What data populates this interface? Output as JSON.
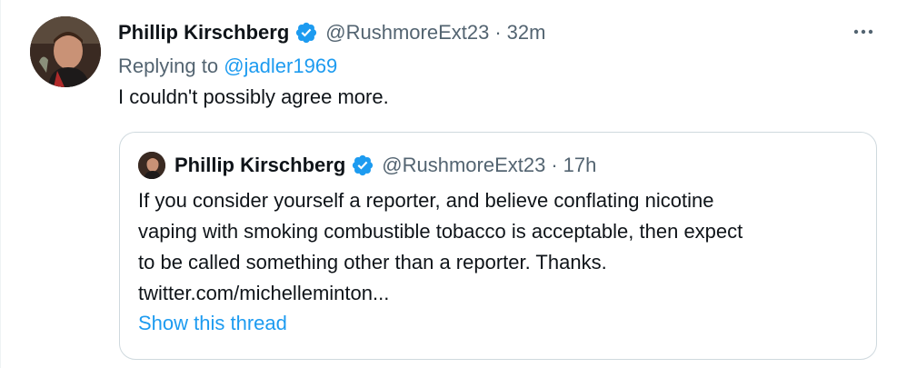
{
  "tweet": {
    "author_name": "Phillip Kirschberg",
    "handle": "@RushmoreExt23",
    "separator": "·",
    "time": "32m",
    "replying_prefix": "Replying to",
    "replying_to": "@jadler1969",
    "text": "I couldn't possibly agree more.",
    "more_icon": "more-horizontal-icon",
    "verified_icon": "verified-badge-icon",
    "verified_color": "#1d9bf0"
  },
  "quote": {
    "author_name": "Phillip Kirschberg",
    "handle": "@RushmoreExt23",
    "separator": "·",
    "time": "17h",
    "lines": [
      "If you consider yourself a reporter, and believe conflating nicotine",
      "vaping with smoking combustible tobacco is acceptable, then expect",
      "to be called something other than a reporter. Thanks.",
      "twitter.com/michelleminton..."
    ],
    "show_thread": "Show this thread"
  },
  "colors": {
    "accent": "#1d9bf0",
    "text_primary": "#0f1419",
    "text_secondary": "#536471",
    "border": "#cfd9de"
  }
}
